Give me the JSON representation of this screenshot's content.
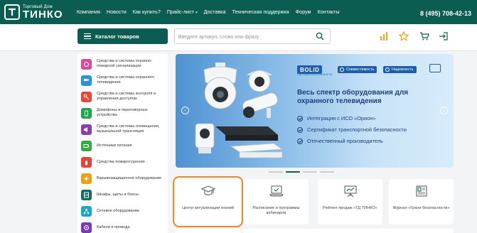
{
  "brand": {
    "sub": "Торговый Дом",
    "name": "ТИНКО"
  },
  "nav": {
    "items": [
      "Компания",
      "Новости",
      "Как купить?",
      "Прайс-лист",
      "Доставка",
      "Техническая поддержка",
      "Форум",
      "Контакты"
    ],
    "dropdown_caret": "▾"
  },
  "phone": "8 (495) 708-42-13",
  "catalog_button": "Каталог товаров",
  "search": {
    "placeholder": "Введите артикул, слово или фразу",
    "value": ""
  },
  "header_icons": [
    "chart-icon",
    "star-icon",
    "cart-icon",
    "login-icon"
  ],
  "sidebar": {
    "items": [
      {
        "label": "Средства и системы охранно-пожарной сигнализации",
        "color": "#d94a9a",
        "icon": "alarm-icon"
      },
      {
        "label": "Средства и системы охранного телевидения",
        "color": "#2f8fd8",
        "icon": "camera-icon"
      },
      {
        "label": "Средства и системы контроля и управления доступом",
        "color": "#e04a3a",
        "icon": "key-icon"
      },
      {
        "label": "Домофоны и переговорные устройства",
        "color": "#26a34a",
        "icon": "intercom-icon"
      },
      {
        "label": "Средства и системы оповещения, музыкальной трансляции",
        "color": "#8a3fb0",
        "icon": "speaker-icon"
      },
      {
        "label": "Источники питания",
        "color": "#3aa844",
        "icon": "battery-icon"
      },
      {
        "label": "Средства пожаротушения",
        "color": "#e0443a",
        "icon": "extinguisher-icon"
      },
      {
        "label": "Взрывозащищенное оборудование",
        "color": "#e9a21f",
        "icon": "explosion-icon"
      },
      {
        "label": "Шкафы, щиты и боксы",
        "color": "#146b60",
        "icon": "cabinet-icon"
      },
      {
        "label": "Сетевое оборудование",
        "color": "#23a3c4",
        "icon": "network-icon"
      },
      {
        "label": "Кабели и провода",
        "color": "#7b3ab5",
        "icon": "cable-icon"
      }
    ]
  },
  "banner": {
    "brand": "BOLID",
    "brand_sub": "СИСТЕМЫ БЕЗОПАСНОСТИ",
    "pills": [
      "Совместимость",
      "Надежность"
    ],
    "title": "Весь спектр оборудования для охранного телевидения",
    "features": [
      "Интеграция с ИСО «Орион»",
      "Сертификат транспортной безопасности",
      "Отечественный производитель"
    ],
    "prev": "‹",
    "next": "›"
  },
  "slider": {
    "slides": 4,
    "active": 2
  },
  "cards": [
    {
      "label": "Центр актуализации знаний",
      "icon": "graduation-cap-icon"
    },
    {
      "label": "Расписание и программы вебинаров",
      "icon": "laptop-icon"
    },
    {
      "label": "Рейтинг продаж «ТД ТИНКО»",
      "icon": "presentation-chart-icon"
    },
    {
      "label": "Журнал «Грани безопасности»",
      "icon": "magazine-icon"
    }
  ],
  "colors": {
    "brand_green": "#0b5d51",
    "highlight": "#f0892e",
    "bolid_blue": "#1f5ea8"
  }
}
